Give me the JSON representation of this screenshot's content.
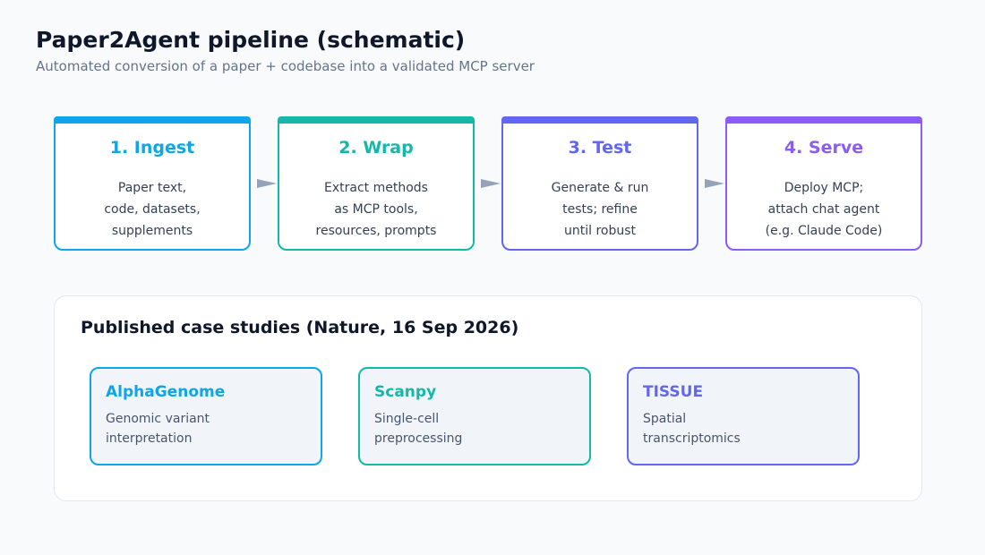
{
  "header": {
    "title": "Paper2Agent pipeline (schematic)",
    "subtitle": "Automated conversion of a paper + codebase into a validated MCP server"
  },
  "steps": [
    {
      "title": "1. Ingest",
      "lines": [
        "Paper text,",
        "code, datasets,",
        "supplements"
      ],
      "color": "#0ea5e9"
    },
    {
      "title": "2. Wrap",
      "lines": [
        "Extract methods",
        "as MCP tools,",
        "resources, prompts"
      ],
      "color": "#14b8a6"
    },
    {
      "title": "3. Test",
      "lines": [
        "Generate & run",
        "tests; refine",
        "until robust"
      ],
      "color": "#6366f1"
    },
    {
      "title": "4. Serve",
      "lines": [
        "Deploy MCP;",
        "attach chat agent",
        "(e.g. Claude Code)"
      ],
      "color": "#8b5cf6"
    }
  ],
  "arrow_color": "#94a3b8",
  "cases_panel": {
    "title": "Published case studies (Nature, 16 Sep 2026)",
    "items": [
      {
        "title": "AlphaGenome",
        "lines": [
          "Genomic variant",
          "interpretation"
        ],
        "color": "#0ea5e9"
      },
      {
        "title": "Scanpy",
        "lines": [
          "Single-cell",
          "preprocessing"
        ],
        "color": "#14b8a6"
      },
      {
        "title": "TISSUE",
        "lines": [
          "Spatial",
          "transcriptomics"
        ],
        "color": "#6366f1"
      }
    ]
  }
}
